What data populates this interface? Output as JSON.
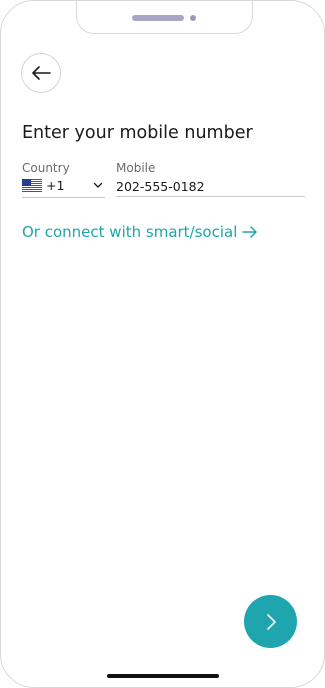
{
  "screen": {
    "title": "Enter your mobile number"
  },
  "country": {
    "label": "Country",
    "flag_icon": "us-flag-icon",
    "dial_code": "+1"
  },
  "mobile": {
    "label": "Mobile",
    "value": "202-555-0182"
  },
  "connect_link": {
    "label": "Or connect with smart/social"
  },
  "colors": {
    "accent": "#1ea5ad",
    "text": "#1a1a1a",
    "muted": "#6b6b6b"
  },
  "icons": {
    "back": "arrow-left-icon",
    "next": "chevron-right-icon",
    "link_arrow": "arrow-right-icon",
    "dropdown": "chevron-down-icon"
  }
}
